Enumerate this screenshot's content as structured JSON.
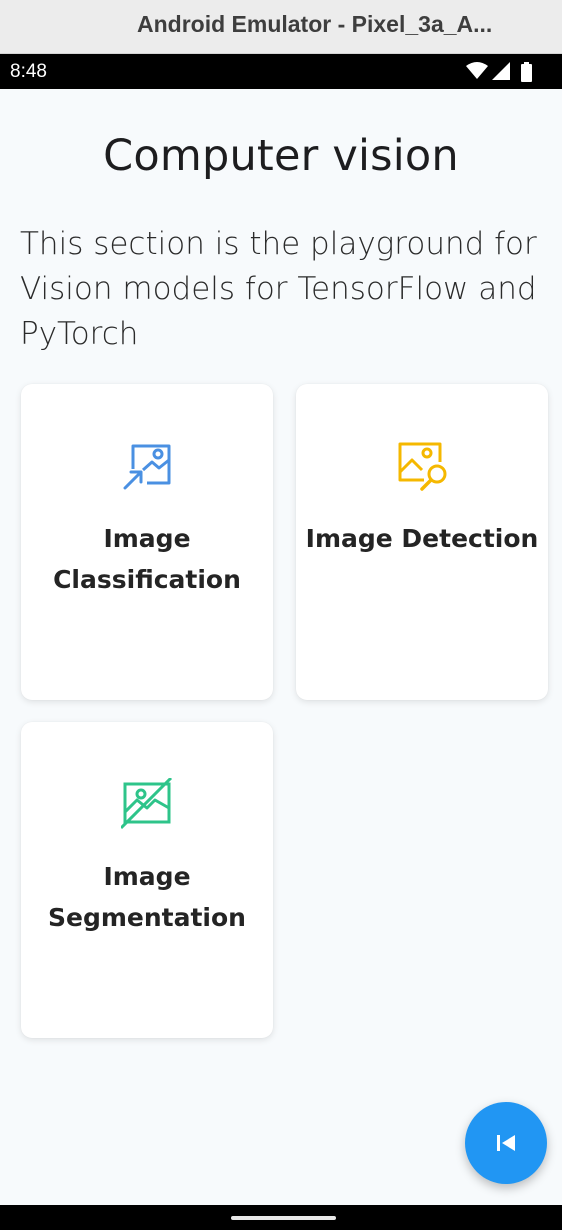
{
  "window": {
    "title": "Android Emulator - Pixel_3a_A..."
  },
  "status_bar": {
    "time": "8:48",
    "icons": [
      "wifi-icon",
      "signal-icon",
      "battery-icon"
    ]
  },
  "page": {
    "title": "Computer vision",
    "description": "This section is the playground for Vision models for TensorFlow and PyTorch"
  },
  "cards": [
    {
      "label": "Image Classification",
      "icon": "image-classification-icon",
      "icon_color": "#4a90e2"
    },
    {
      "label": "Image Detection",
      "icon": "image-search-icon",
      "icon_color": "#f5b800"
    },
    {
      "label": "Image Segmentation",
      "icon": "image-segmentation-icon",
      "icon_color": "#2ec48a"
    }
  ],
  "fab": {
    "icon": "skip-previous-icon",
    "color": "#2196f3"
  }
}
